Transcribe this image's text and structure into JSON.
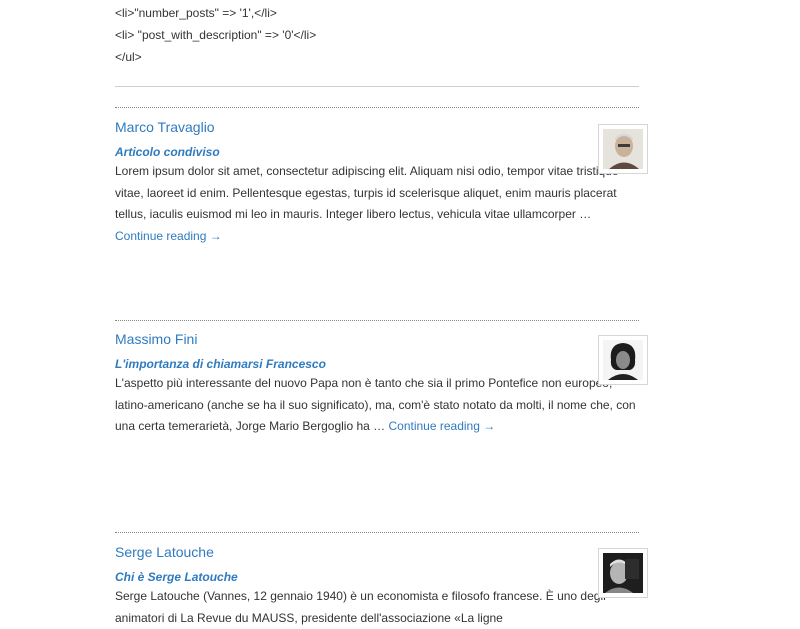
{
  "code_lines": [
    "<li>\"number_posts\" => '1',</li>",
    "<li> \"post_with_description\" => '0'</li>",
    "</ul>"
  ],
  "entries": [
    {
      "author": "Marco Travaglio",
      "title": "Articolo condiviso",
      "excerpt": "Lorem ipsum dolor sit amet, consectetur adipiscing elit. Aliquam nisi odio, tempor vitae tristique vitae, laoreet id enim. Pellentesque egestas, turpis id scelerisque aliquet, enim mauris placerat tellus, iaculis euismod mi leo in mauris. Integer libero lectus, vehicula vitae ullamcorper …",
      "more": "Continue reading →",
      "avatar_colors": [
        "#e8e4df",
        "#b8a58f",
        "#5a4a3c"
      ]
    },
    {
      "author": "Massimo Fini",
      "title": "L'importanza di chiamarsi Francesco",
      "excerpt": "L'aspetto più interessante del nuovo Papa non è tanto che sia il primo Pontefice non europeo, latino-americano (anche se ha il suo significato), ma, com'è stato notato da molti, il nome che, con una certa temerarietà, Jorge Mario Bergoglio ha …",
      "more": "Continue reading →",
      "avatar_colors": [
        "#f2f2f2",
        "#1a1a1a",
        "#777777"
      ]
    },
    {
      "author": "Serge Latouche",
      "title": "Chi è Serge Latouche",
      "excerpt": "Serge Latouche (Vannes, 12 gennaio 1940) è un economista e filosofo francese. È uno degli animatori di La Revue du MAUSS, presidente dell'associazione «La ligne",
      "more": "",
      "avatar_colors": [
        "#cfcfcf",
        "#2a2a2a",
        "#9a9a9a"
      ]
    }
  ]
}
